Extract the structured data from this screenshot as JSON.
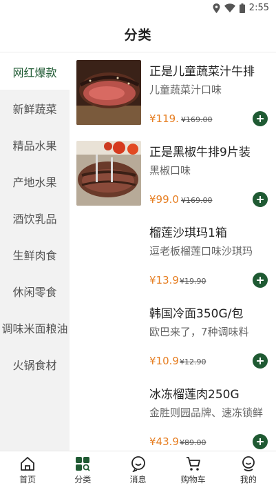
{
  "status_bar": {
    "time": "2:55"
  },
  "header": {
    "title": "分类"
  },
  "sidebar": {
    "items": [
      {
        "label": "网红爆款",
        "active": true
      },
      {
        "label": "新鲜蔬菜",
        "active": false
      },
      {
        "label": "精品水果",
        "active": false
      },
      {
        "label": "产地水果",
        "active": false
      },
      {
        "label": "酒饮乳品",
        "active": false
      },
      {
        "label": "生鲜肉食",
        "active": false
      },
      {
        "label": "休闲零食",
        "active": false
      },
      {
        "label": "调味米面粮油",
        "active": false
      },
      {
        "label": "火锅食材",
        "active": false
      }
    ]
  },
  "products": [
    {
      "name": "正是儿童蔬菜汁牛排",
      "desc": "儿童蔬菜汁口味",
      "price": "¥119.",
      "original_price": "¥169.00",
      "image": "steak-grilled"
    },
    {
      "name": "正是黑椒牛排9片装",
      "desc": "黑椒口味",
      "price": "¥99.0",
      "original_price": "¥169.00",
      "image": "steak-pepper"
    },
    {
      "name": "榴莲沙琪玛1箱",
      "desc": "逗老板榴莲口味沙琪玛",
      "price": "¥13.9",
      "original_price": "¥19.90",
      "image": ""
    },
    {
      "name": "韩国冷面350G/包",
      "desc": "欧巴来了，7种调味料",
      "price": "¥10.9",
      "original_price": "¥12.90",
      "image": ""
    },
    {
      "name": "冰冻榴莲肉250G",
      "desc": "金胜则园品牌、速冻锁鲜",
      "price": "¥43.9",
      "original_price": "¥89.00",
      "image": ""
    }
  ],
  "tabbar": {
    "items": [
      {
        "label": "首页",
        "icon": "home-icon",
        "active": false
      },
      {
        "label": "分类",
        "icon": "category-icon",
        "active": true
      },
      {
        "label": "消息",
        "icon": "message-icon",
        "active": false
      },
      {
        "label": "购物车",
        "icon": "cart-icon",
        "active": false
      },
      {
        "label": "我的",
        "icon": "profile-icon",
        "active": false
      }
    ]
  },
  "colors": {
    "accent": "#1f5a33",
    "price": "#e67e22",
    "sidebar_bg": "#f2f2f2"
  }
}
